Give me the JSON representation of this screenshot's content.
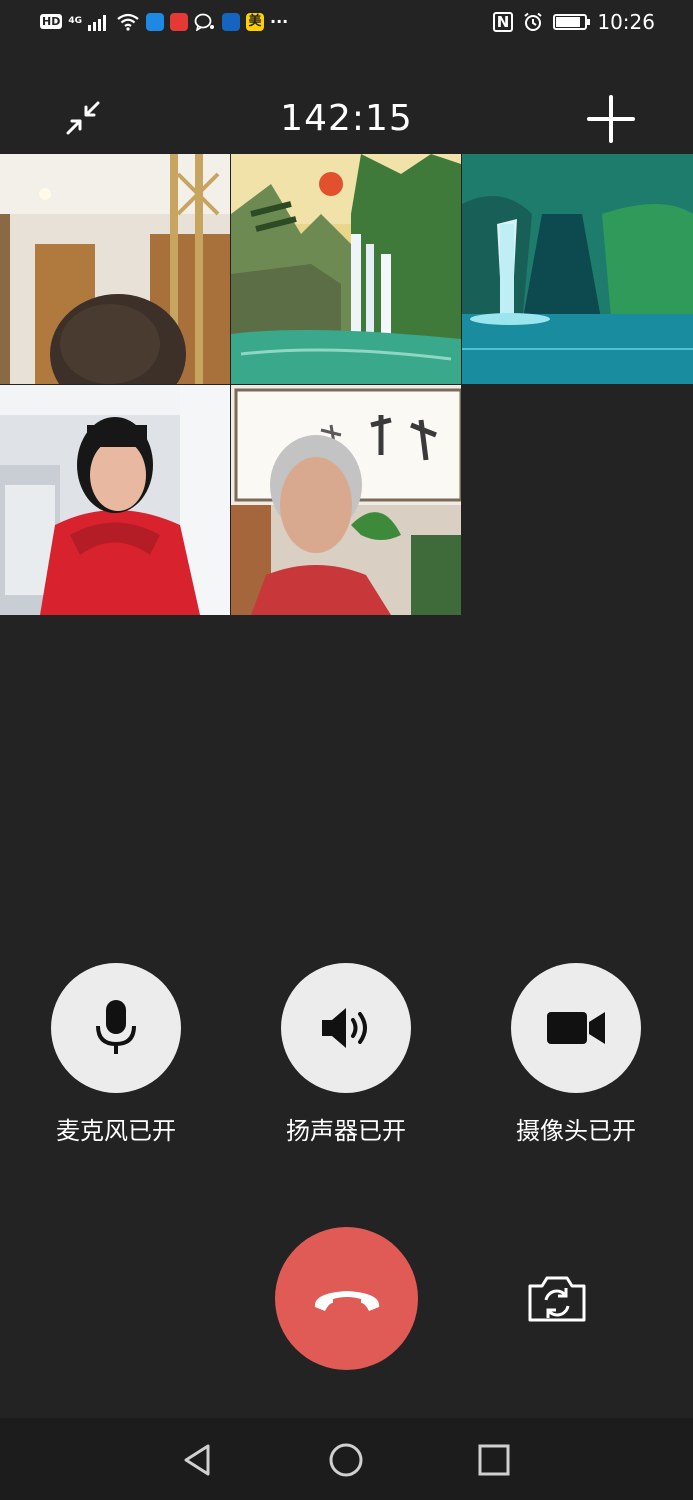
{
  "status_bar": {
    "hd_label": "HD",
    "network_label": "4G",
    "apps": [
      {
        "name": "app-icon-1",
        "color": "#1e88e5"
      },
      {
        "name": "app-icon-2",
        "color": "#e53935"
      },
      {
        "name": "app-icon-3",
        "color": "#ffffff"
      },
      {
        "name": "app-icon-4",
        "color": "#1565c0"
      },
      {
        "name": "meituan-icon",
        "color": "#ffd100",
        "label": "美"
      }
    ],
    "more_label": "···",
    "nfc_label": "N",
    "time": "10:26"
  },
  "call": {
    "duration": "142:15"
  },
  "participants": [
    {
      "label": "participant-1",
      "scene": "room-hair"
    },
    {
      "label": "participant-2",
      "scene": "landscape-waterfall-painting"
    },
    {
      "label": "participant-3",
      "scene": "waterfall-lagoon"
    },
    {
      "label": "participant-4",
      "scene": "woman-red-coat"
    },
    {
      "label": "participant-5",
      "scene": "woman-calligraphy"
    }
  ],
  "controls": {
    "microphone_label": "麦克风已开",
    "speaker_label": "扬声器已开",
    "camera_label": "摄像头已开"
  },
  "colors": {
    "background": "#232323",
    "control_bg": "#ececec",
    "hangup": "#e05b56",
    "nav_bar": "#1c1c1c"
  }
}
